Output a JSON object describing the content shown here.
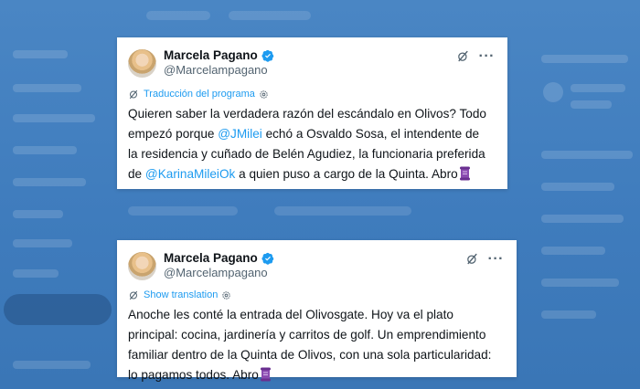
{
  "tweets": [
    {
      "display_name": "Marcela Pagano",
      "handle": "@Marcelampagano",
      "translation_label": "Traducción del programa",
      "text_parts": [
        "Quieren saber la verdadera razón del escándalo en Olivos? Todo empezó porque ",
        "@JMilei",
        " echó a Osvaldo Sosa, el intendente de la residencia y cuñado de Belén Agudiez, la funcionaria preferida de ",
        "@KarinaMileiOk",
        " a quien puso a cargo de la Quinta. Abro"
      ],
      "emoji": "scroll"
    },
    {
      "display_name": "Marcela Pagano",
      "handle": "@Marcelampagano",
      "translation_label": "Show translation",
      "text": "Anoche les conté la entrada del Olivosgate. Hoy va el plato principal: cocina, jardinería y carritos de golf. Un emprendimiento familiar dentro de la Quinta de Olivos, con una sola particularidad: lo pagamos todos. Abro",
      "emoji": "scroll"
    }
  ],
  "colors": {
    "background": "#4a86c4",
    "link": "#1d9bf0",
    "text": "#0f1419",
    "secondary_text": "#536471",
    "verified": "#1d9bf0",
    "scroll_emoji": "#7b3fa0"
  },
  "icons": [
    "verified-badge-icon",
    "grok-icon",
    "more-icon",
    "translate-icon",
    "gear-icon",
    "scroll-emoji-icon"
  ]
}
